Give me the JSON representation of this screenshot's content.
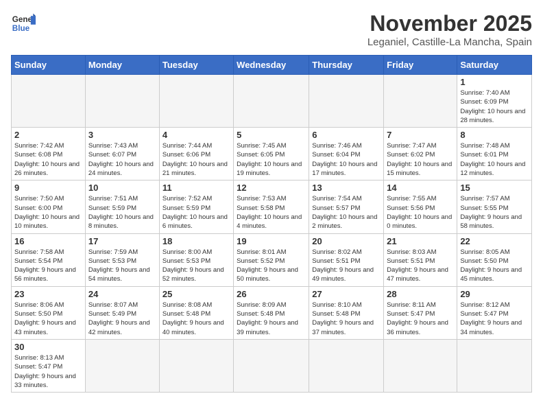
{
  "header": {
    "logo_line1": "General",
    "logo_line2": "Blue",
    "month": "November 2025",
    "location": "Leganiel, Castille-La Mancha, Spain"
  },
  "weekdays": [
    "Sunday",
    "Monday",
    "Tuesday",
    "Wednesday",
    "Thursday",
    "Friday",
    "Saturday"
  ],
  "days": {
    "d1": {
      "num": "1",
      "sunrise": "7:40 AM",
      "sunset": "6:09 PM",
      "daylight": "10 hours and 28 minutes."
    },
    "d2": {
      "num": "2",
      "sunrise": "7:42 AM",
      "sunset": "6:08 PM",
      "daylight": "10 hours and 26 minutes."
    },
    "d3": {
      "num": "3",
      "sunrise": "7:43 AM",
      "sunset": "6:07 PM",
      "daylight": "10 hours and 24 minutes."
    },
    "d4": {
      "num": "4",
      "sunrise": "7:44 AM",
      "sunset": "6:06 PM",
      "daylight": "10 hours and 21 minutes."
    },
    "d5": {
      "num": "5",
      "sunrise": "7:45 AM",
      "sunset": "6:05 PM",
      "daylight": "10 hours and 19 minutes."
    },
    "d6": {
      "num": "6",
      "sunrise": "7:46 AM",
      "sunset": "6:04 PM",
      "daylight": "10 hours and 17 minutes."
    },
    "d7": {
      "num": "7",
      "sunrise": "7:47 AM",
      "sunset": "6:02 PM",
      "daylight": "10 hours and 15 minutes."
    },
    "d8": {
      "num": "8",
      "sunrise": "7:48 AM",
      "sunset": "6:01 PM",
      "daylight": "10 hours and 12 minutes."
    },
    "d9": {
      "num": "9",
      "sunrise": "7:50 AM",
      "sunset": "6:00 PM",
      "daylight": "10 hours and 10 minutes."
    },
    "d10": {
      "num": "10",
      "sunrise": "7:51 AM",
      "sunset": "5:59 PM",
      "daylight": "10 hours and 8 minutes."
    },
    "d11": {
      "num": "11",
      "sunrise": "7:52 AM",
      "sunset": "5:59 PM",
      "daylight": "10 hours and 6 minutes."
    },
    "d12": {
      "num": "12",
      "sunrise": "7:53 AM",
      "sunset": "5:58 PM",
      "daylight": "10 hours and 4 minutes."
    },
    "d13": {
      "num": "13",
      "sunrise": "7:54 AM",
      "sunset": "5:57 PM",
      "daylight": "10 hours and 2 minutes."
    },
    "d14": {
      "num": "14",
      "sunrise": "7:55 AM",
      "sunset": "5:56 PM",
      "daylight": "10 hours and 0 minutes."
    },
    "d15": {
      "num": "15",
      "sunrise": "7:57 AM",
      "sunset": "5:55 PM",
      "daylight": "9 hours and 58 minutes."
    },
    "d16": {
      "num": "16",
      "sunrise": "7:58 AM",
      "sunset": "5:54 PM",
      "daylight": "9 hours and 56 minutes."
    },
    "d17": {
      "num": "17",
      "sunrise": "7:59 AM",
      "sunset": "5:53 PM",
      "daylight": "9 hours and 54 minutes."
    },
    "d18": {
      "num": "18",
      "sunrise": "8:00 AM",
      "sunset": "5:53 PM",
      "daylight": "9 hours and 52 minutes."
    },
    "d19": {
      "num": "19",
      "sunrise": "8:01 AM",
      "sunset": "5:52 PM",
      "daylight": "9 hours and 50 minutes."
    },
    "d20": {
      "num": "20",
      "sunrise": "8:02 AM",
      "sunset": "5:51 PM",
      "daylight": "9 hours and 49 minutes."
    },
    "d21": {
      "num": "21",
      "sunrise": "8:03 AM",
      "sunset": "5:51 PM",
      "daylight": "9 hours and 47 minutes."
    },
    "d22": {
      "num": "22",
      "sunrise": "8:05 AM",
      "sunset": "5:50 PM",
      "daylight": "9 hours and 45 minutes."
    },
    "d23": {
      "num": "23",
      "sunrise": "8:06 AM",
      "sunset": "5:50 PM",
      "daylight": "9 hours and 43 minutes."
    },
    "d24": {
      "num": "24",
      "sunrise": "8:07 AM",
      "sunset": "5:49 PM",
      "daylight": "9 hours and 42 minutes."
    },
    "d25": {
      "num": "25",
      "sunrise": "8:08 AM",
      "sunset": "5:48 PM",
      "daylight": "9 hours and 40 minutes."
    },
    "d26": {
      "num": "26",
      "sunrise": "8:09 AM",
      "sunset": "5:48 PM",
      "daylight": "9 hours and 39 minutes."
    },
    "d27": {
      "num": "27",
      "sunrise": "8:10 AM",
      "sunset": "5:48 PM",
      "daylight": "9 hours and 37 minutes."
    },
    "d28": {
      "num": "28",
      "sunrise": "8:11 AM",
      "sunset": "5:47 PM",
      "daylight": "9 hours and 36 minutes."
    },
    "d29": {
      "num": "29",
      "sunrise": "8:12 AM",
      "sunset": "5:47 PM",
      "daylight": "9 hours and 34 minutes."
    },
    "d30": {
      "num": "30",
      "sunrise": "8:13 AM",
      "sunset": "5:47 PM",
      "daylight": "9 hours and 33 minutes."
    }
  }
}
